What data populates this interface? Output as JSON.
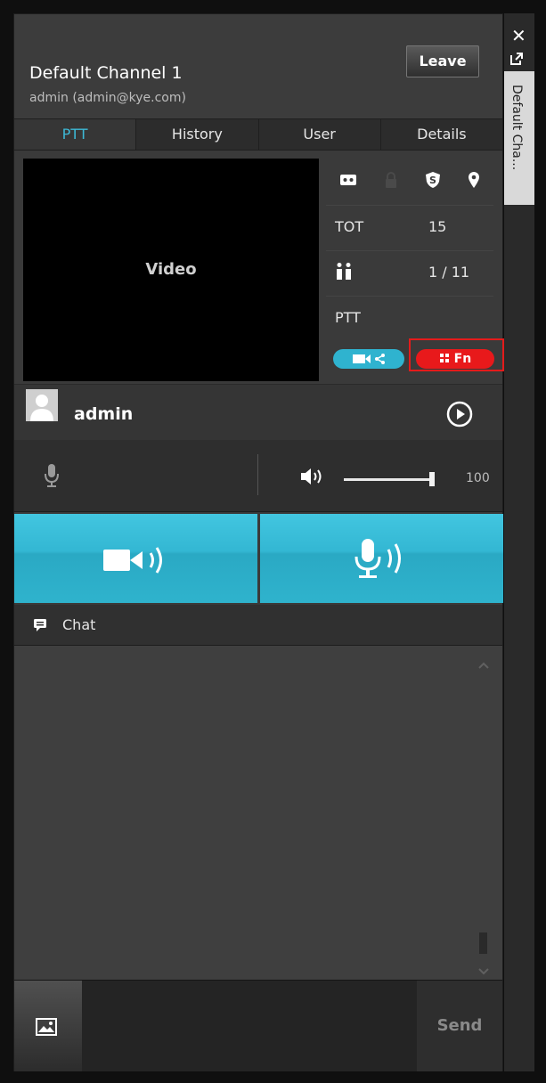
{
  "channel": {
    "title": "Default Channel 1",
    "subtitle": "admin (admin@kye.com)",
    "leave_label": "Leave"
  },
  "tabs": [
    {
      "label": "PTT",
      "active": true
    },
    {
      "label": "History"
    },
    {
      "label": "User"
    },
    {
      "label": "Details"
    }
  ],
  "video": {
    "label": "Video"
  },
  "info": {
    "tot_label": "TOT",
    "tot_value": "15",
    "users_value": "1 / 11",
    "ptt_label": "PTT",
    "fn_label": "Fn"
  },
  "user": {
    "name": "admin"
  },
  "audio": {
    "volume": "100"
  },
  "chat": {
    "label": "Chat",
    "send_label": "Send"
  },
  "side": {
    "tab_label": "Default Cha..."
  },
  "colors": {
    "accent": "#2fb3cf",
    "fn": "#e8191b",
    "highlight": "#e41b1b"
  },
  "icons": [
    "cassette-icon",
    "lock-icon",
    "shield-icon",
    "location-pin-icon",
    "users-icon",
    "video-share-icon",
    "grid-icon",
    "play-icon",
    "microphone-icon",
    "speaker-icon",
    "video-call-icon",
    "voice-call-icon",
    "chat-icon",
    "image-icon",
    "close-icon",
    "popout-icon"
  ]
}
